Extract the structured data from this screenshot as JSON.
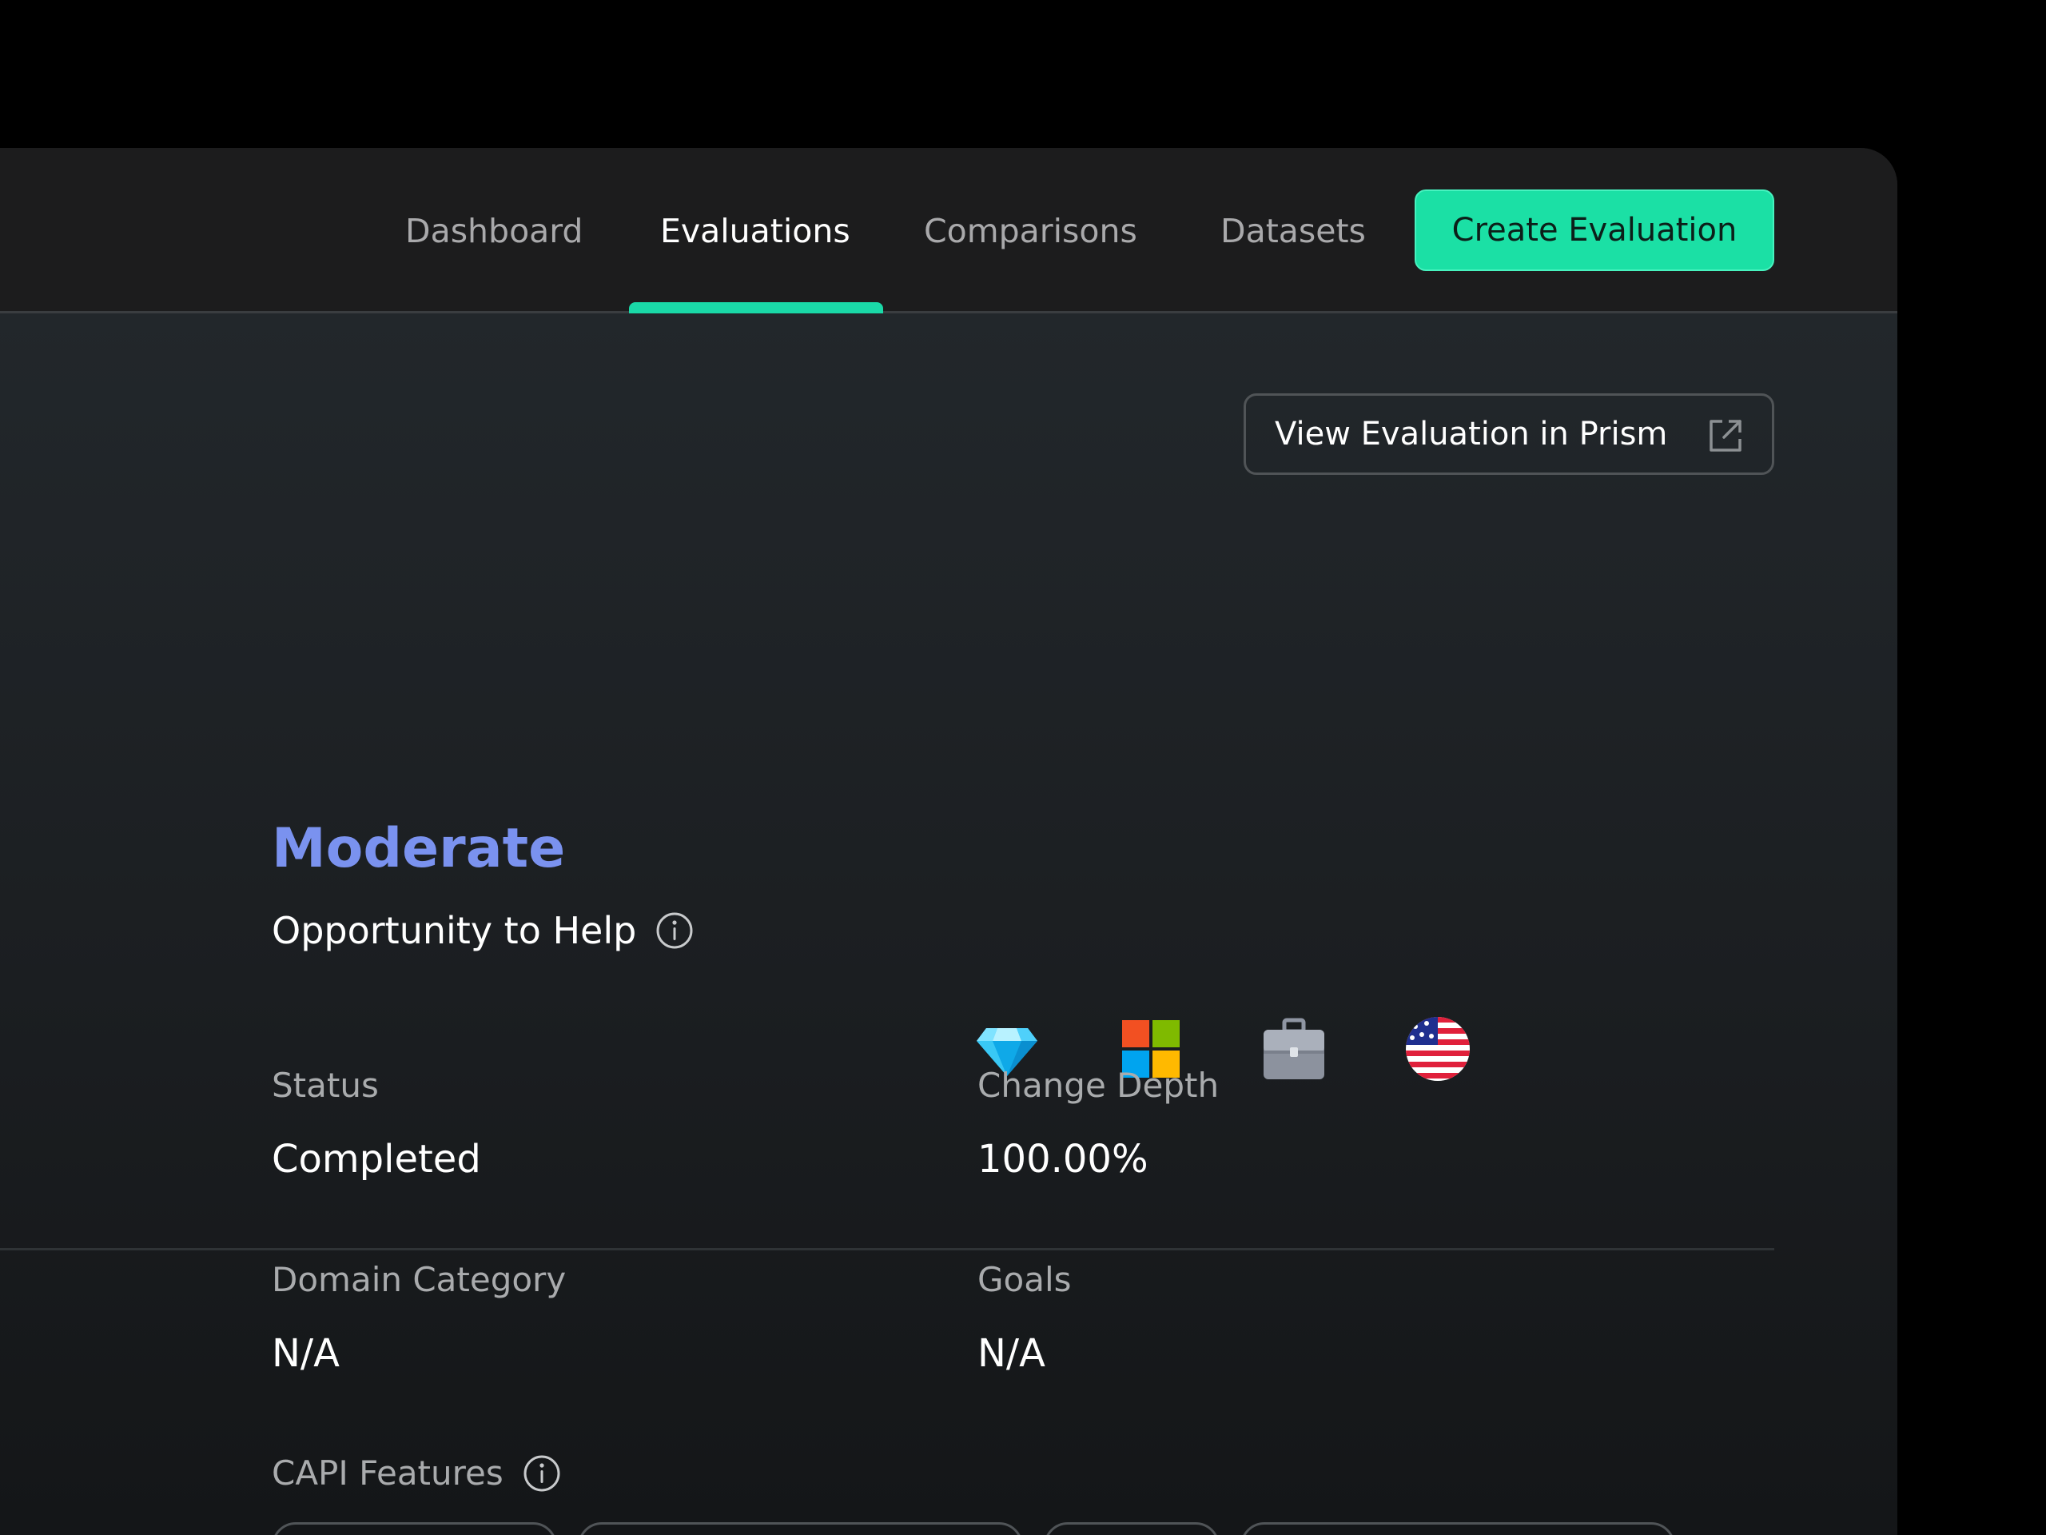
{
  "nav": {
    "tabs": [
      {
        "label": "Dashboard",
        "active": false
      },
      {
        "label": "Evaluations",
        "active": true
      },
      {
        "label": "Comparisons",
        "active": false
      },
      {
        "label": "Datasets",
        "active": false
      }
    ],
    "create_label": "Create Evaluation"
  },
  "colors": {
    "accent": "#1be0a5",
    "level": "#7a92ef",
    "background": "#1c1c1d"
  },
  "header": {
    "prism_label": "View Evaluation in Prism",
    "prism_icon": "external-link-icon"
  },
  "summary": {
    "level": "Moderate",
    "opportunity_label": "Opportunity to Help",
    "info_icon": "info-icon",
    "badges": [
      "gem-icon",
      "microsoft-logo-icon",
      "briefcase-icon",
      "us-flag-icon"
    ]
  },
  "details": {
    "status_label": "Status",
    "status_value": "Completed",
    "change_depth_label": "Change Depth",
    "change_depth_value": "100.00%",
    "domain_label": "Domain Category",
    "domain_value": "N/A",
    "goals_label": "Goals",
    "goals_value": "N/A",
    "capi_label": "CAPI Features"
  }
}
